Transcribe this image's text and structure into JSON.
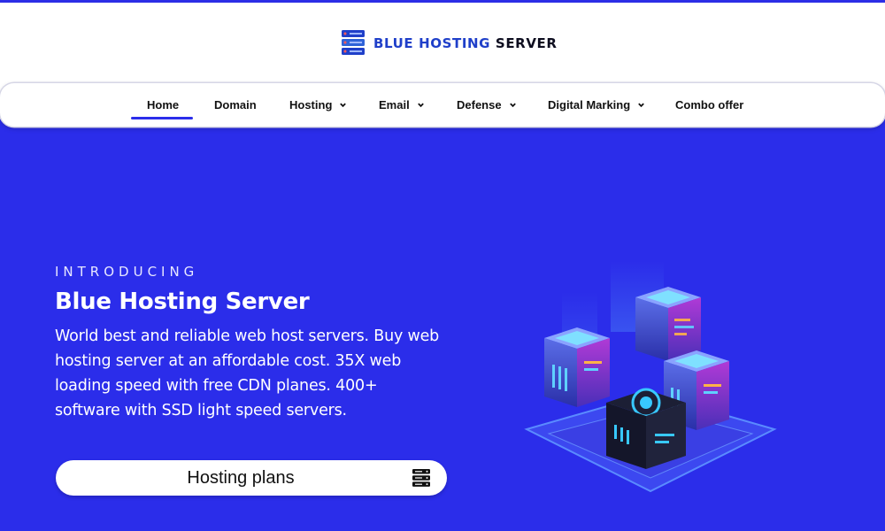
{
  "header": {
    "logo_icon": "server-stack-icon",
    "logo_part1": "BLUE HOSTING",
    "logo_part2": "SERVER",
    "brand_color": "#1f3fc9"
  },
  "nav": {
    "active": "Home",
    "accent": "#2b2dea",
    "items": [
      {
        "label": "Home",
        "has_dropdown": false
      },
      {
        "label": "Domain",
        "has_dropdown": false
      },
      {
        "label": "Hosting",
        "has_dropdown": true
      },
      {
        "label": "Email",
        "has_dropdown": true
      },
      {
        "label": "Defense",
        "has_dropdown": true
      },
      {
        "label": "Digital Marking",
        "has_dropdown": true
      },
      {
        "label": "Combo offer",
        "has_dropdown": false
      }
    ]
  },
  "hero": {
    "background": "#2b2dea",
    "eyebrow": "INTRODUCING",
    "title": "Blue Hosting Server",
    "description_lines": [
      "World best and reliable web host servers. Buy web",
      "hosting server at an affordable cost. 35X web",
      "loading speed with free CDN planes. 400+",
      "software with SSD light speed servers."
    ],
    "cta_label": "Hosting plans",
    "cta_icon": "server-stack-icon",
    "illustration": "isometric-servers-illustration"
  }
}
